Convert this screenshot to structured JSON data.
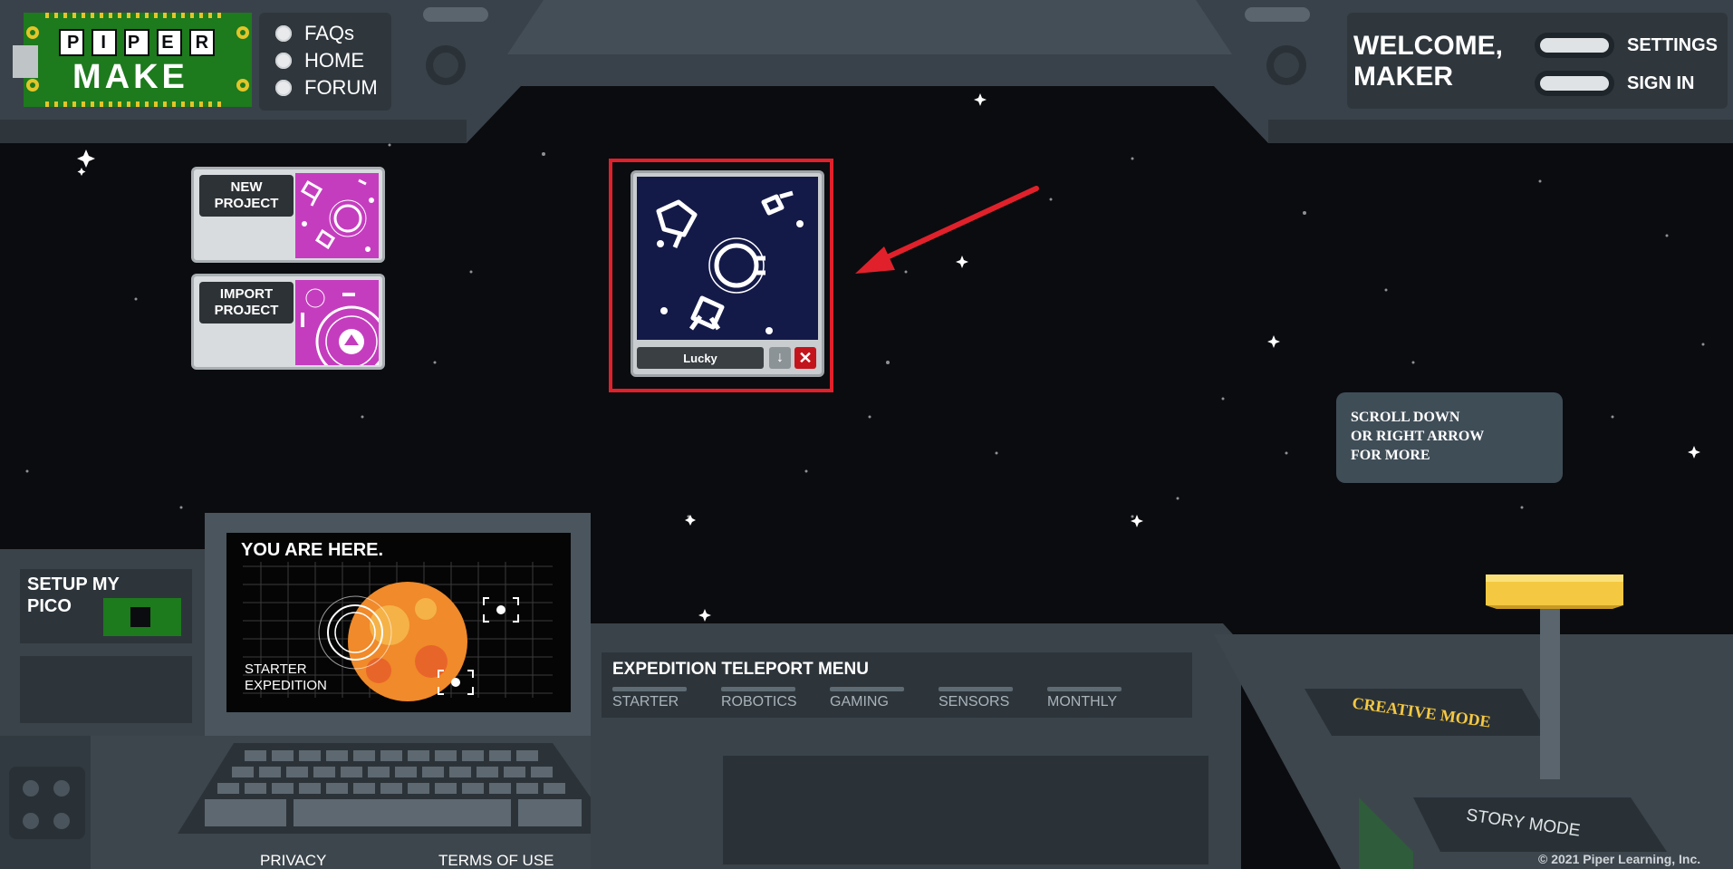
{
  "logo": {
    "line1": "PIPER",
    "line2": "MAKE"
  },
  "nav": {
    "items": [
      {
        "label": "FAQs"
      },
      {
        "label": "HOME"
      },
      {
        "label": "FORUM"
      }
    ]
  },
  "header": {
    "welcome": "WELCOME,",
    "welcome2": "MAKER",
    "settings_label": "SETTINGS",
    "signin_label": "SIGN IN"
  },
  "tiles": {
    "new_project": "NEW\nPROJECT",
    "import_project": "IMPORT\nPROJECT"
  },
  "project_card": {
    "name": "Lucky",
    "download_icon": "download-arrow-icon",
    "delete_icon": "close-x-icon"
  },
  "scroll_hint": "SCROLL DOWN\nOR RIGHT ARROW\nFOR MORE",
  "pico": {
    "line1": "SETUP MY",
    "line2": "PICO"
  },
  "screen": {
    "you_are_here": "YOU ARE HERE.",
    "expedition1": "STARTER",
    "expedition2": "EXPEDITION"
  },
  "expedition_menu": {
    "title": "EXPEDITION TELEPORT MENU",
    "tabs": [
      {
        "label": "STARTER"
      },
      {
        "label": "ROBOTICS"
      },
      {
        "label": "GAMING"
      },
      {
        "label": "SENSORS"
      },
      {
        "label": "MONTHLY"
      }
    ]
  },
  "modes": {
    "creative": "CREATIVE MODE",
    "story": "STORY MODE"
  },
  "footer": {
    "privacy": "PRIVACY",
    "terms": "TERMS OF USE",
    "copyright": "© 2021 Piper Learning, Inc."
  },
  "colors": {
    "accent_red": "#e0212b",
    "panel_gray": "#3d464d",
    "creative_yellow": "#f5c842",
    "pcb_green": "#1d7a1d",
    "card_navy": "#141a48",
    "tile_magenta": "#c53dbf"
  }
}
